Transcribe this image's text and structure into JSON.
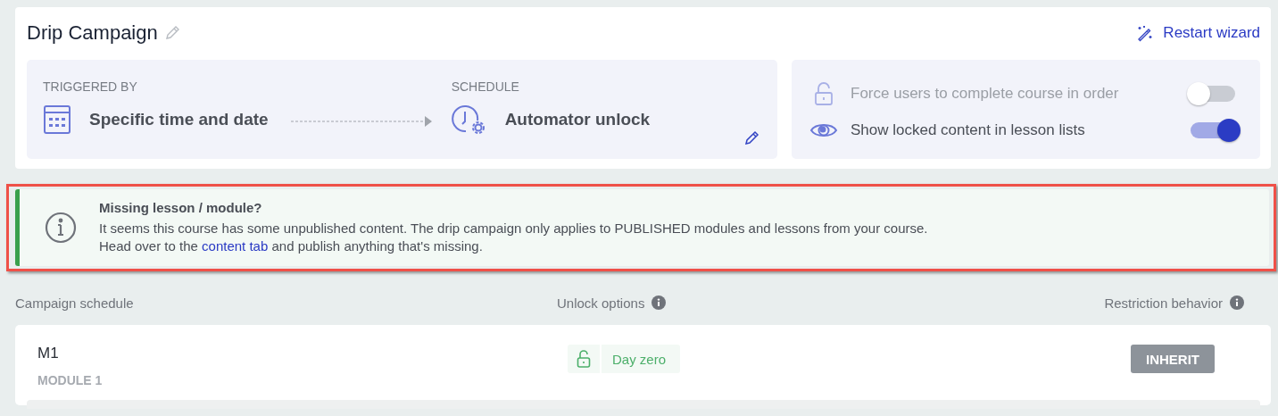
{
  "header": {
    "title": "Drip Campaign",
    "restart_link": "Restart wizard"
  },
  "flow": {
    "trigger": {
      "label": "TRIGGERED BY",
      "value": "Specific time and date"
    },
    "schedule": {
      "label": "SCHEDULE",
      "value": "Automator unlock"
    }
  },
  "settings": [
    {
      "kind": "lock",
      "label": "Force users to complete course in order",
      "on": false,
      "disabled": true
    },
    {
      "kind": "eye",
      "label": "Show locked content in lesson lists",
      "on": true,
      "disabled": false
    }
  ],
  "notice": {
    "title": "Missing lesson / module?",
    "line_1": "It seems this course has some unpublished content. The drip campaign only applies to PUBLISHED modules and lessons from your course.",
    "line_2_before": "Head over to the",
    "link": "content tab",
    "line_2_after": "and publish anything that's missing."
  },
  "columns": [
    "Campaign schedule",
    "Unlock options",
    "Restriction behavior"
  ],
  "rows": [
    {
      "name": "M1",
      "type": "MODULE 1",
      "unlock": "Day zero",
      "restriction": "INHERIT"
    }
  ]
}
